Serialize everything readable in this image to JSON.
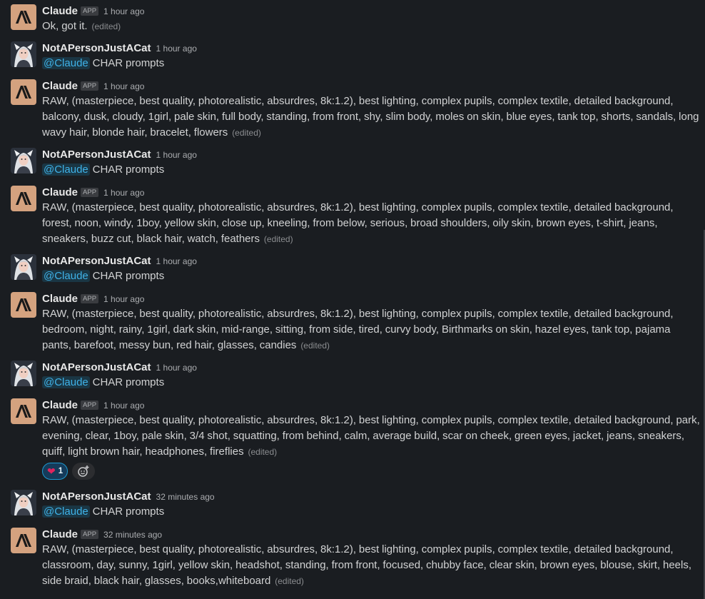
{
  "messages": [
    {
      "author": "Claude",
      "badge": "APP",
      "avatar": "claude",
      "time": "1 hour ago",
      "text": "Ok, got it.",
      "edited": "(edited)"
    },
    {
      "author": "NotAPersonJustACat",
      "avatar": "cat",
      "time": "1 hour ago",
      "mention": "@Claude",
      "text": "CHAR prompts"
    },
    {
      "author": "Claude",
      "badge": "APP",
      "avatar": "claude",
      "time": "1 hour ago",
      "text": "RAW, (masterpiece, best quality, photorealistic, absurdres, 8k:1.2), best lighting, complex pupils, complex textile, detailed background, balcony, dusk, cloudy, 1girl, pale skin, full body, standing, from front, shy, slim body, moles on skin, blue eyes, tank top, shorts, sandals, long wavy hair, blonde hair, bracelet, flowers",
      "edited": "(edited)"
    },
    {
      "author": "NotAPersonJustACat",
      "avatar": "cat",
      "time": "1 hour ago",
      "mention": "@Claude",
      "text": "CHAR prompts"
    },
    {
      "author": "Claude",
      "badge": "APP",
      "avatar": "claude",
      "time": "1 hour ago",
      "text": "RAW, (masterpiece, best quality, photorealistic, absurdres, 8k:1.2), best lighting, complex pupils, complex textile, detailed background, forest, noon, windy, 1boy, yellow skin, close up, kneeling, from below, serious, broad shoulders, oily skin, brown eyes, t-shirt, jeans, sneakers, buzz cut, black hair, watch, feathers",
      "edited": "(edited)"
    },
    {
      "author": "NotAPersonJustACat",
      "avatar": "cat",
      "time": "1 hour ago",
      "mention": "@Claude",
      "text": "CHAR prompts"
    },
    {
      "author": "Claude",
      "badge": "APP",
      "avatar": "claude",
      "time": "1 hour ago",
      "text": "RAW, (masterpiece, best quality, photorealistic, absurdres, 8k:1.2), best lighting, complex pupils, complex textile, detailed background, bedroom, night, rainy, 1girl, dark skin, mid-range, sitting, from side, tired, curvy body, Birthmarks on skin, hazel eyes, tank top, pajama pants, barefoot, messy bun, red hair, glasses, candies",
      "edited": "(edited)"
    },
    {
      "author": "NotAPersonJustACat",
      "avatar": "cat",
      "time": "1 hour ago",
      "mention": "@Claude",
      "text": "CHAR prompts"
    },
    {
      "author": "Claude",
      "badge": "APP",
      "avatar": "claude",
      "time": "1 hour ago",
      "text": "RAW, (masterpiece, best quality, photorealistic, absurdres, 8k:1.2), best lighting, complex pupils, complex textile, detailed background, park, evening, clear, 1boy, pale skin, 3/4 shot, squatting, from behind, calm, average build, scar on cheek, green eyes, jacket, jeans, sneakers, quiff, light brown hair, headphones, fireflies",
      "edited": "(edited)",
      "reactions": [
        {
          "emoji": "❤",
          "count": "1"
        }
      ]
    },
    {
      "author": "NotAPersonJustACat",
      "avatar": "cat",
      "time": "32 minutes ago",
      "mention": "@Claude",
      "text": "CHAR prompts"
    },
    {
      "author": "Claude",
      "badge": "APP",
      "avatar": "claude",
      "time": "32 minutes ago",
      "text": "RAW, (masterpiece, best quality, photorealistic, absurdres, 8k:1.2), best lighting, complex pupils, complex textile, detailed background, classroom, day, sunny, 1girl, yellow skin, headshot, standing, from front, focused, chubby face, clear skin, brown eyes, blouse, skirt, heels, side braid, black hair, glasses, books,whiteboard",
      "edited": "(edited)"
    }
  ],
  "colors": {
    "background": "#1a1d21",
    "claude_avatar": "#d4a27f",
    "mention": "#3fb2e8",
    "reaction_border": "#1d9bd1"
  },
  "icons": {
    "claude_avatar": "anthropic-logo-icon",
    "cat_avatar": "user-portrait-icon",
    "add_reaction": "add-emoji-icon"
  }
}
